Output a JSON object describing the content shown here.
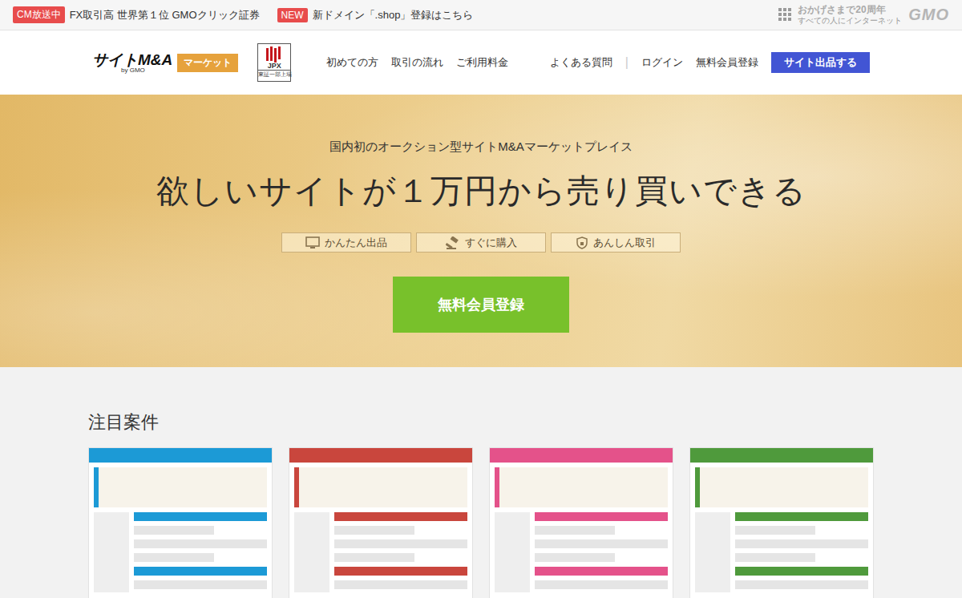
{
  "topbar": {
    "promos": [
      {
        "badge": "CM放送中",
        "text": "FX取引高 世界第１位 GMOクリック証券"
      },
      {
        "badge": "NEW",
        "text": "新ドメイン「.shop」登録はこちら"
      }
    ],
    "anniversary": [
      "おかげさまで20周年",
      "すべての人にインターネット"
    ],
    "brand": "GMO"
  },
  "header": {
    "logo": {
      "name": "サイトM&A",
      "by": "by GMO",
      "badge": "マーケット"
    },
    "listing": {
      "mark": "JPX",
      "text": "東証一部上場"
    },
    "nav": [
      "初めての方",
      "取引の流れ",
      "ご利用料金"
    ],
    "faq": "よくある質問",
    "separator": "|",
    "links": [
      "ログイン",
      "無料会員登録"
    ],
    "cta": "サイト出品する"
  },
  "hero": {
    "lead": "国内初のオークション型サイトM&Aマーケットプレイス",
    "title": "欲しいサイトが１万円から売り買いできる",
    "features": [
      "かんたん出品",
      "すぐに購入",
      "あんしん取引"
    ],
    "signup": "無料会員登録"
  },
  "featured": {
    "title": "注目案件",
    "cards": [
      {
        "color": "#1c9ad6"
      },
      {
        "color": "#c9463d"
      },
      {
        "color": "#e4528a"
      },
      {
        "color": "#4f9a3c"
      }
    ]
  }
}
